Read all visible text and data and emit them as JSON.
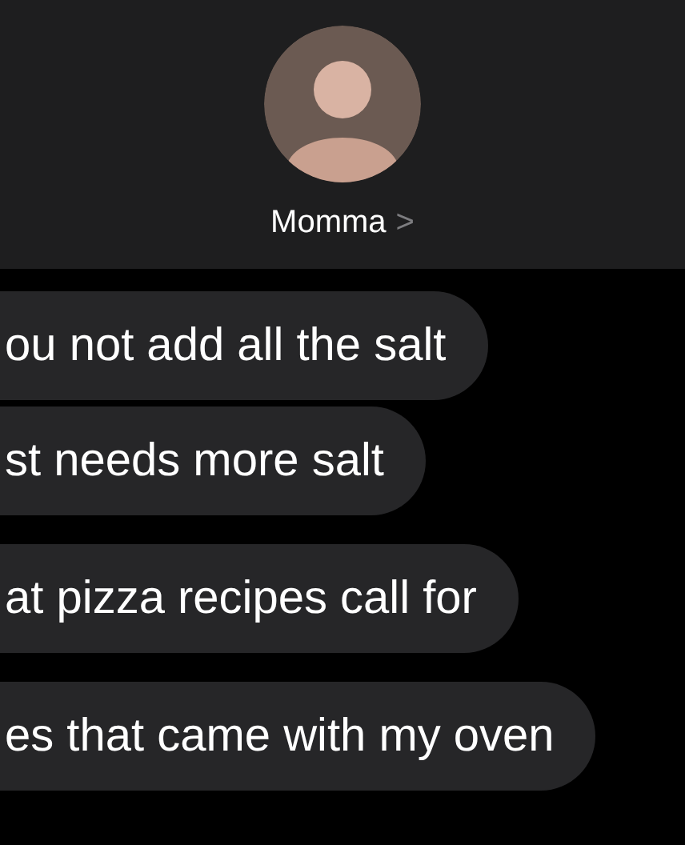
{
  "contact": {
    "name": "Momma",
    "chevron": ">"
  },
  "messages": [
    {
      "text": "ou not add all the salt"
    },
    {
      "text": "st needs more salt"
    },
    {
      "text": "at pizza recipes call for"
    },
    {
      "text": "es that came with my oven"
    }
  ]
}
